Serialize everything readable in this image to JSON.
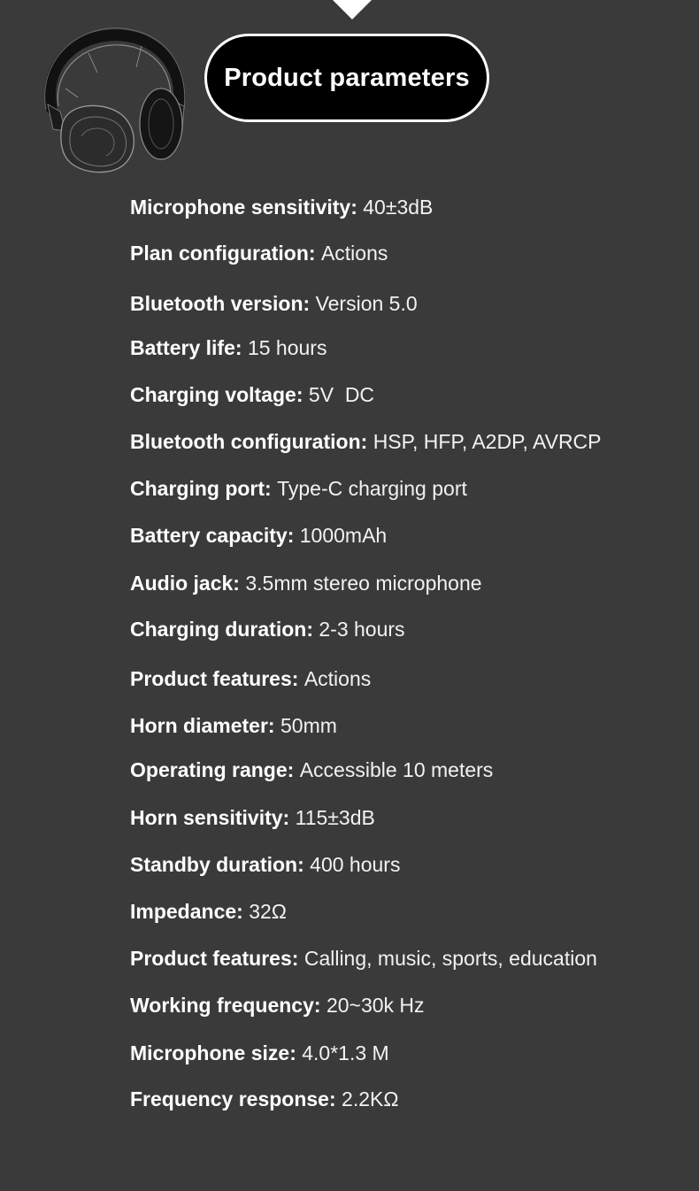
{
  "title": "Product parameters",
  "icons": {
    "top_marker": "triangle-down-icon",
    "product_illustration": "headphones-icon"
  },
  "colors": {
    "background": "#3a3a3a",
    "pill_background": "#000000",
    "pill_border": "#ffffff",
    "text": "#ffffff"
  },
  "specs": [
    {
      "label": "Microphone sensitivity:",
      "value": "40±3dB"
    },
    {
      "label": "Plan configuration:",
      "value": "Actions"
    },
    {
      "label": "Bluetooth version:",
      "value": "Version 5.0"
    },
    {
      "label": "Battery life:",
      "value": "15 hours"
    },
    {
      "label": "Charging voltage:",
      "value": "5V  DC"
    },
    {
      "label": "Bluetooth configuration:",
      "value": "HSP, HFP, A2DP, AVRCP"
    },
    {
      "label": "Charging port:",
      "value": "Type-C charging port"
    },
    {
      "label": "Battery capacity:",
      "value": "1000mAh"
    },
    {
      "label": "Audio jack:",
      "value": "3.5mm stereo microphone"
    },
    {
      "label": "Charging duration:",
      "value": "2-3 hours"
    },
    {
      "label": "Product features:",
      "value": "Actions"
    },
    {
      "label": "Horn diameter:",
      "value": "50mm"
    },
    {
      "label": "Operating range:",
      "value": "Accessible 10 meters"
    },
    {
      "label": "Horn sensitivity:",
      "value": "115±3dB"
    },
    {
      "label": "Standby duration:",
      "value": "400 hours"
    },
    {
      "label": "Impedance:",
      "value": "32Ω"
    },
    {
      "label": "Product features:",
      "value": "Calling, music, sports, education"
    },
    {
      "label": "Working frequency:",
      "value": "20~30k Hz"
    },
    {
      "label": "Microphone size:",
      "value": "4.0*1.3 M"
    },
    {
      "label": "Frequency response:",
      "value": "2.2KΩ"
    }
  ]
}
